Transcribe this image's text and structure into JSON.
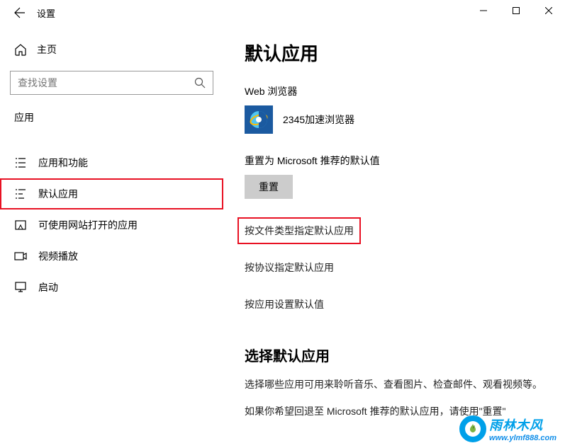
{
  "titlebar": {
    "title": "设置"
  },
  "sidebar": {
    "home": "主页",
    "search_placeholder": "查找设置",
    "section": "应用",
    "items": [
      {
        "label": "应用和功能"
      },
      {
        "label": "默认应用"
      },
      {
        "label": "可使用网站打开的应用"
      },
      {
        "label": "视频播放"
      },
      {
        "label": "启动"
      }
    ]
  },
  "main": {
    "title": "默认应用",
    "web_browser_label": "Web 浏览器",
    "web_browser_app": "2345加速浏览器",
    "reset_label": "重置为 Microsoft 推荐的默认值",
    "reset_button": "重置",
    "links": [
      "按文件类型指定默认应用",
      "按协议指定默认应用",
      "按应用设置默认值"
    ],
    "choose_title": "选择默认应用",
    "choose_text1": "选择哪些应用可用来聆听音乐、查看图片、检查邮件、观看视频等。",
    "choose_text2": "如果你希望回退至 Microsoft 推荐的默认应用，请使用\"重置\""
  },
  "watermark": {
    "cn": "雨林木风",
    "url": "www.ylmf888.com"
  }
}
